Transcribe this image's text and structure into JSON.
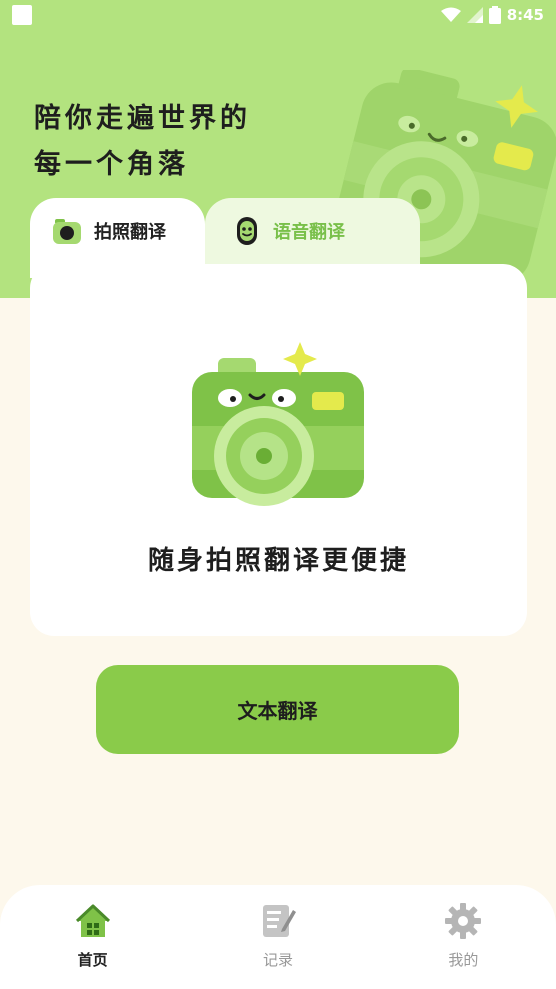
{
  "status_bar": {
    "time": "8:45"
  },
  "hero": {
    "slogan_line1": "陪你走遍世界的",
    "slogan_line2": "每一个角落"
  },
  "tabs": [
    {
      "label": "拍照翻译",
      "active": true
    },
    {
      "label": "语音翻译",
      "active": false
    }
  ],
  "card": {
    "caption": "随身拍照翻译更便捷"
  },
  "actions": {
    "text_translate_label": "文本翻译"
  },
  "bottom_nav": [
    {
      "label": "首页",
      "icon": "home-icon",
      "active": true
    },
    {
      "label": "记录",
      "icon": "notes-icon",
      "active": false
    },
    {
      "label": "我的",
      "icon": "gear-icon",
      "active": false
    }
  ],
  "colors": {
    "hero_bg": "#b3e37f",
    "accent": "#8acb4a",
    "page_bg": "#fdf8ec"
  }
}
